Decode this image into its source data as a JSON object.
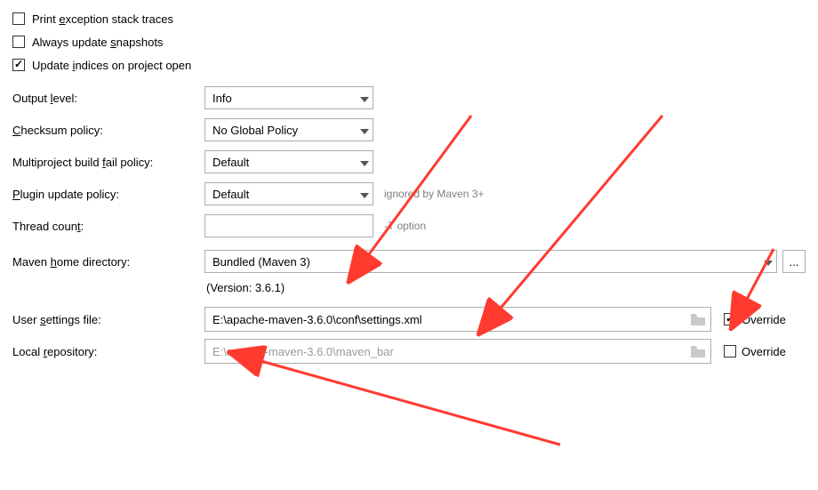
{
  "checkboxes": {
    "print_exception": {
      "label_pre": "Print ",
      "u": "e",
      "label_post": "xception stack traces",
      "checked": false
    },
    "always_update": {
      "label_pre": "Always update ",
      "u": "s",
      "label_post": "napshots",
      "checked": false
    },
    "update_indices": {
      "label_pre": "Update ",
      "u": "i",
      "label_post": "ndices on project open",
      "checked": true
    }
  },
  "output_level": {
    "label_pre": "Output ",
    "u": "l",
    "label_post": "evel:",
    "value": "Info"
  },
  "checksum_policy": {
    "label_pre": "",
    "u": "C",
    "label_post": "hecksum policy:",
    "value": "No Global Policy"
  },
  "multiproject": {
    "label_pre": "Multiproject build ",
    "u": "f",
    "label_post": "ail policy:",
    "value": "Default"
  },
  "plugin_update": {
    "label_pre": "",
    "u": "P",
    "label_post": "lugin update policy:",
    "value": "Default",
    "hint": "ignored by Maven 3+"
  },
  "thread_count": {
    "label_pre": "Thread coun",
    "u": "t",
    "label_post": ":",
    "value": "",
    "hint": "-T option"
  },
  "maven_home": {
    "label_pre": "Maven ",
    "u": "h",
    "label_post": "ome directory:",
    "value": "Bundled (Maven 3)"
  },
  "version_text": "(Version: 3.6.1)",
  "user_settings": {
    "label_pre": "User ",
    "u": "s",
    "label_post": "ettings file:",
    "value": "E:\\apache-maven-3.6.0\\conf\\settings.xml"
  },
  "local_repo": {
    "label_pre": "Local ",
    "u": "r",
    "label_post": "epository:",
    "value": "E:\\apache-maven-3.6.0\\maven_bar"
  },
  "override_label": "Override",
  "override_user_settings": true,
  "override_local_repo": false,
  "browse_label": "..."
}
